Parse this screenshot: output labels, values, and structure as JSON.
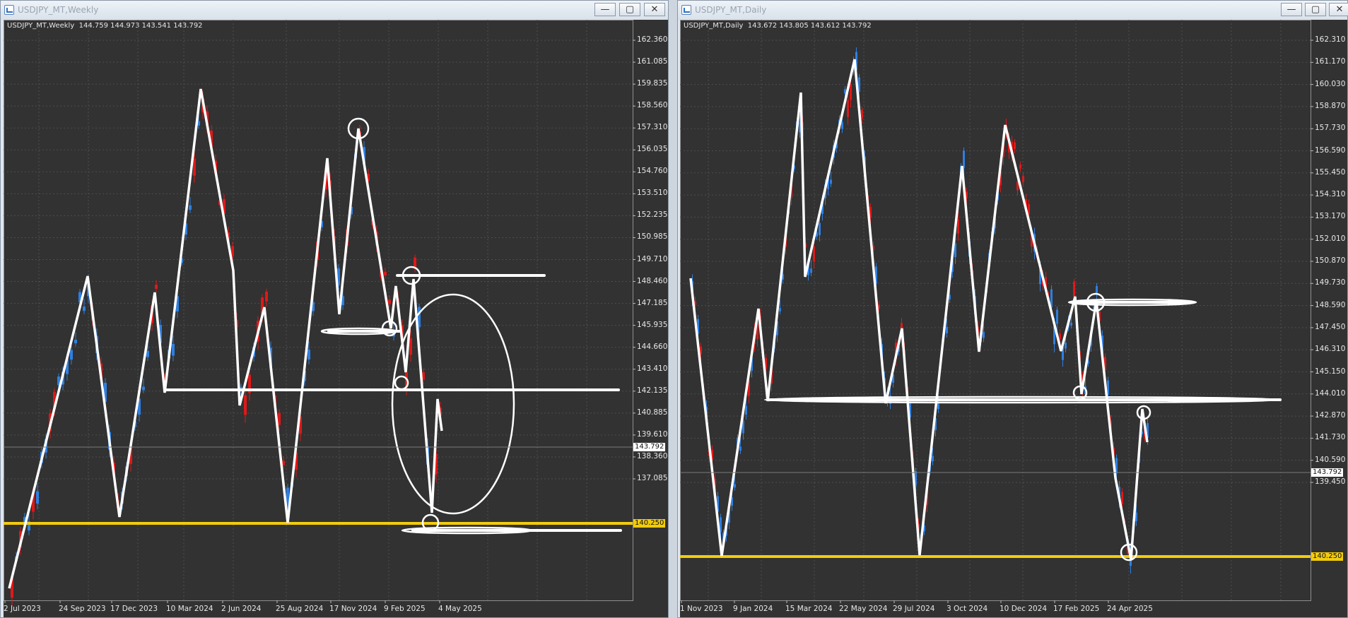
{
  "weekly": {
    "window_title": "USDJPY_MT,Weekly",
    "info_line": "USDJPY_MT,Weekly  144.759 144.973 143.541 143.792",
    "price_labels": [
      "162.360",
      "161.085",
      "159.835",
      "158.560",
      "157.310",
      "156.035",
      "154.760",
      "153.510",
      "152.235",
      "150.985",
      "149.710",
      "148.460",
      "147.185",
      "145.935",
      "144.660",
      "143.410",
      "142.135",
      "140.885",
      "139.610",
      "138.360",
      "137.085"
    ],
    "time_labels": [
      "2 Jul 2023",
      "24 Sep 2023",
      "17 Dec 2023",
      "10 Mar 2024",
      "2 Jun 2024",
      "25 Aug 2024",
      "17 Nov 2024",
      "9 Feb 2025",
      "4 May 2025"
    ],
    "current_price": "143.792",
    "support_price": "140.250"
  },
  "daily": {
    "window_title": "USDJPY_MT,Daily",
    "info_line": "USDJPY_MT,Daily  143.672 143.805 143.612 143.792",
    "price_labels": [
      "162.310",
      "161.170",
      "160.030",
      "158.870",
      "157.730",
      "156.590",
      "155.450",
      "154.310",
      "153.170",
      "152.010",
      "150.870",
      "149.730",
      "148.590",
      "147.450",
      "146.310",
      "145.150",
      "144.010",
      "142.870",
      "141.730",
      "140.590",
      "139.450"
    ],
    "time_labels": [
      "1 Nov 2023",
      "9 Jan 2024",
      "15 Mar 2024",
      "22 May 2024",
      "29 Jul 2024",
      "3 Oct 2024",
      "10 Dec 2024",
      "17 Feb 2025",
      "24 Apr 2025"
    ],
    "current_price": "143.792",
    "support_price": "140.250"
  },
  "window_buttons": {
    "minimize": "—",
    "maximize": "▢",
    "close": "✕"
  },
  "colors": {
    "background": "#323232",
    "grid": "#4d4d4d",
    "bull": "#2f7fe0",
    "bear": "#e01818",
    "support": "#f2cc0c",
    "drawing": "#ffffff"
  }
}
